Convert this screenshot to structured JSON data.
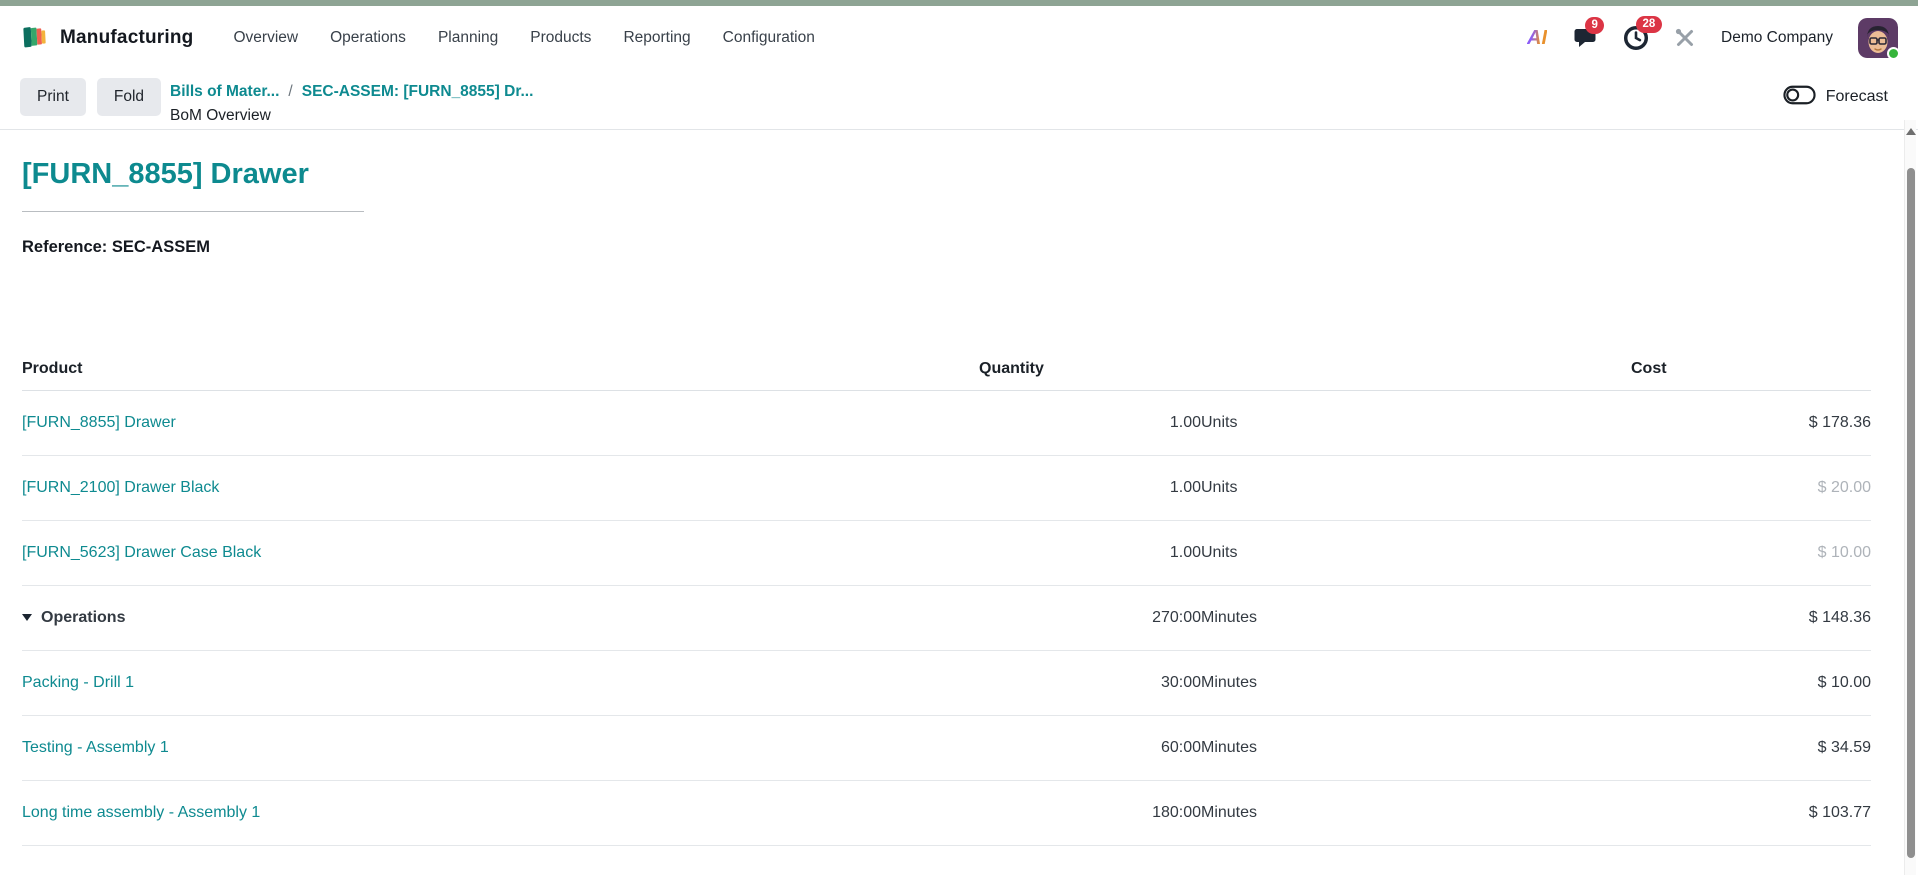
{
  "nav": {
    "app_name": "Manufacturing",
    "menu_items": [
      "Overview",
      "Operations",
      "Planning",
      "Products",
      "Reporting",
      "Configuration"
    ],
    "ai_label": "AI",
    "message_badge": "9",
    "activity_badge": "28",
    "company": "Demo Company"
  },
  "control_panel": {
    "print_label": "Print",
    "fold_label": "Fold",
    "breadcrumb": {
      "parent": "Bills of Mater...",
      "separator": "/",
      "current": "SEC-ASSEM: [FURN_8855] Dr...",
      "subtitle": "BoM Overview"
    },
    "forecast_label": "Forecast"
  },
  "page": {
    "title": "[FURN_8855] Drawer",
    "reference": "Reference: SEC-ASSEM"
  },
  "table": {
    "headers": {
      "product": "Product",
      "quantity": "Quantity",
      "cost": "Cost"
    },
    "rows": [
      {
        "product": "[FURN_8855] Drawer",
        "quantity": "1.00",
        "unit": "Units",
        "cost": "$ 178.36"
      },
      {
        "product": "[FURN_2100] Drawer Black",
        "quantity": "1.00",
        "unit": "Units",
        "cost": "$ 20.00"
      },
      {
        "product": "[FURN_5623] Drawer Case Black",
        "quantity": "1.00",
        "unit": "Units",
        "cost": "$ 10.00"
      },
      {
        "product": "Operations",
        "quantity": "270:00",
        "unit": "Minutes",
        "cost": "$ 148.36"
      },
      {
        "product": "Packing - Drill 1",
        "quantity": "30:00",
        "unit": "Minutes",
        "cost": "$ 10.00"
      },
      {
        "product": "Testing - Assembly 1",
        "quantity": "60:00",
        "unit": "Minutes",
        "cost": "$ 34.59"
      },
      {
        "product": "Long time assembly - Assembly 1",
        "quantity": "180:00",
        "unit": "Minutes",
        "cost": "$ 103.77"
      }
    ]
  },
  "colors": {
    "accent_teal": "#0e8a90",
    "badge_red": "#dc3545",
    "muted_cost": "#aeb3b9",
    "top_strip_green": "#8ea494",
    "status_online_green": "#35b43a"
  }
}
